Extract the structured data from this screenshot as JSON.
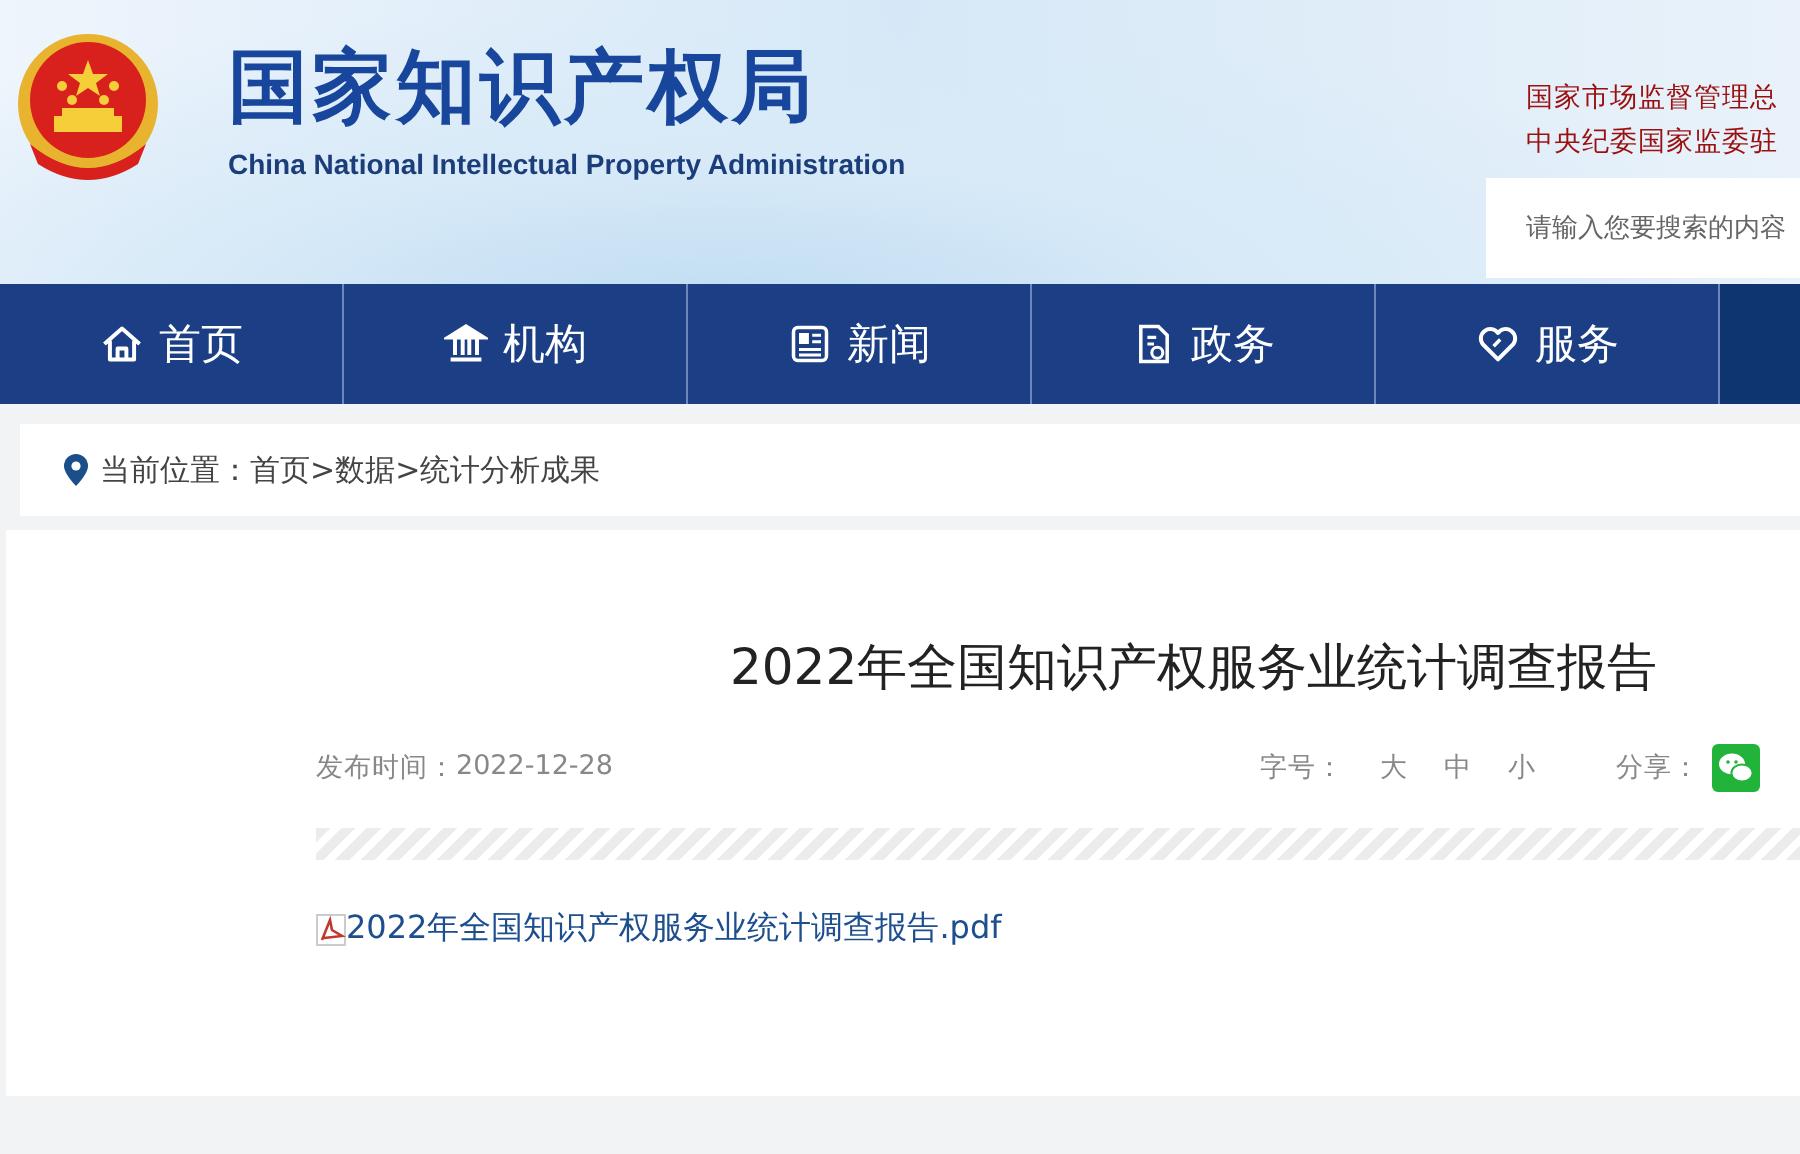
{
  "site": {
    "title": "国家知识产权局",
    "subtitle": "China National Intellectual Property Administration"
  },
  "header_links": [
    "国家市场监督管理总",
    "中央纪委国家监委驻"
  ],
  "search": {
    "placeholder": "请输入您要搜索的内容"
  },
  "nav": [
    {
      "label": "首页",
      "kind": "home"
    },
    {
      "label": "机构",
      "kind": "building"
    },
    {
      "label": "新闻",
      "kind": "newspaper"
    },
    {
      "label": "政务",
      "kind": "document"
    },
    {
      "label": "服务",
      "kind": "heart"
    }
  ],
  "breadcrumb": {
    "label": "当前位置：",
    "separator": ">",
    "items": [
      "首页",
      "数据",
      "统计分析成果"
    ]
  },
  "article": {
    "title": "2022年全国知识产权服务业统计调查报告",
    "date_label": "发布时间：",
    "date": "2022-12-28",
    "font_size_label": "字号：",
    "font_sizes": [
      "大",
      "中",
      "小"
    ],
    "share_label": "分享：",
    "attachment": "2022年全国知识产权服务业统计调查报告.pdf"
  }
}
